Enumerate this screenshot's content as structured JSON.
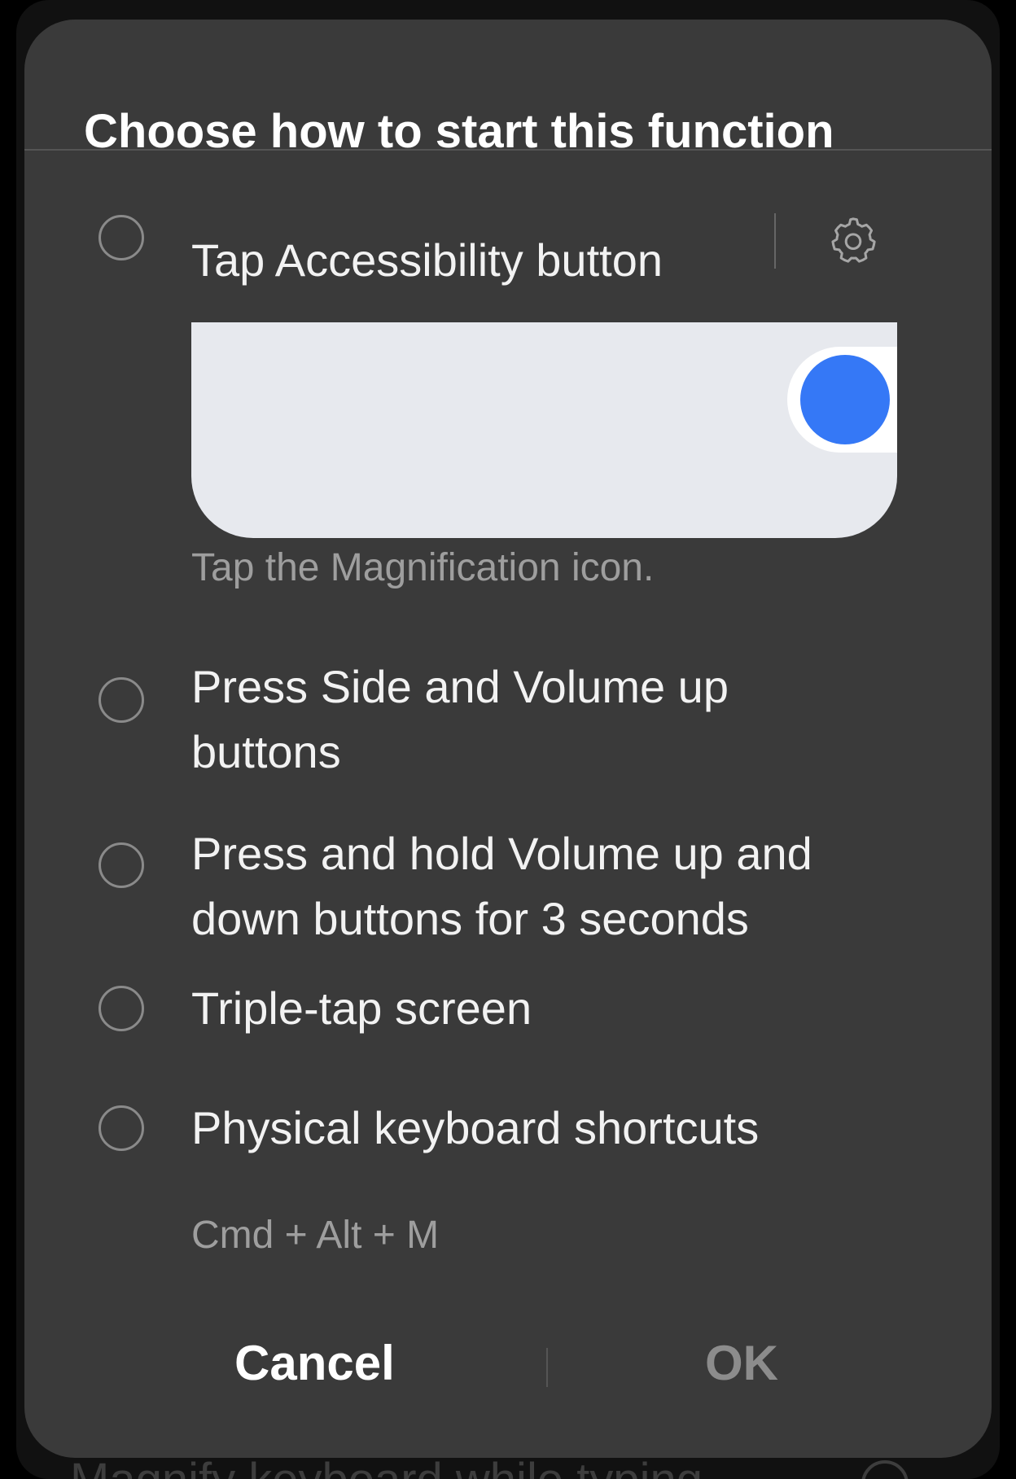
{
  "dialog": {
    "title": "Choose how to start this function",
    "options": [
      {
        "label": "Tap Accessibility button",
        "selected": false
      },
      {
        "label": "Press Side and Volume up buttons",
        "selected": false
      },
      {
        "label": "Press and hold Volume up and down buttons for 3 seconds",
        "selected": false
      },
      {
        "label": "Triple-tap screen",
        "selected": false
      },
      {
        "label": "Physical keyboard shortcuts",
        "selected": false
      }
    ],
    "option0_hint": "Tap the Magnification icon.",
    "option4_shortcut": "Cmd + Alt + M",
    "settings_icon": "gear-icon",
    "preview_dot_color": "#3578f6",
    "cancel_label": "Cancel",
    "ok_label": "OK"
  },
  "background": {
    "partial_item_label": "Magnify keyboard while typing"
  }
}
